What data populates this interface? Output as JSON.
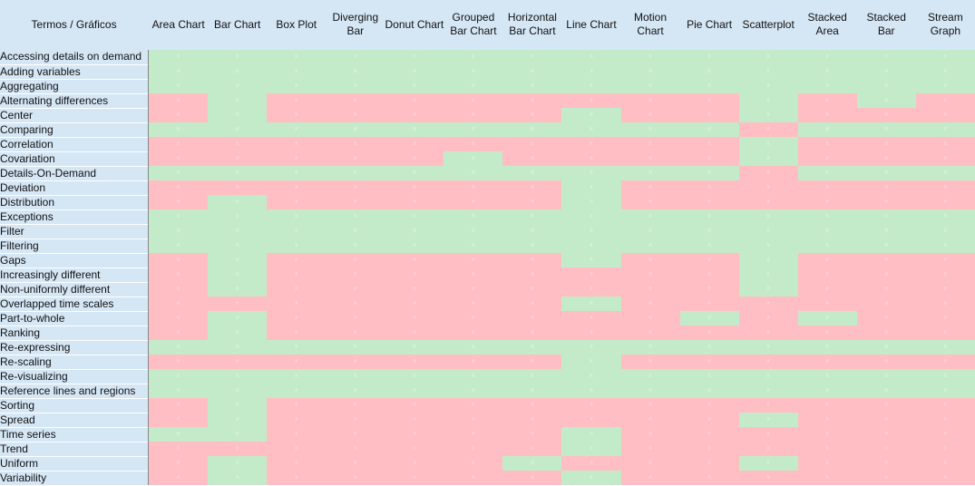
{
  "header": {
    "corner": "Termos / Gráficos",
    "columns": [
      "Area Chart",
      "Bar Chart",
      "Box Plot",
      "Diverging Bar",
      "Donut Chart",
      "Grouped Bar Chart",
      "Horizontal Bar Chart",
      "Line Chart",
      "Motion Chart",
      "Pie Chart",
      "Scatterplot",
      "Stacked Area",
      "Stacked Bar",
      "Stream Graph"
    ]
  },
  "colors": {
    "header_bg": "#d5e6f5",
    "yes": "#c4ebc9",
    "no": "#ffbec4"
  },
  "cell_mark": "x",
  "rows": [
    {
      "label": "Accessing details on demand",
      "values": [
        1,
        1,
        1,
        1,
        1,
        1,
        1,
        1,
        1,
        1,
        1,
        1,
        1,
        1
      ]
    },
    {
      "label": "Adding variables",
      "values": [
        1,
        1,
        1,
        1,
        1,
        1,
        1,
        1,
        1,
        1,
        1,
        1,
        1,
        1
      ]
    },
    {
      "label": "Aggregating",
      "values": [
        1,
        1,
        1,
        1,
        1,
        1,
        1,
        1,
        1,
        1,
        1,
        1,
        1,
        1
      ]
    },
    {
      "label": "Alternating differences",
      "values": [
        0,
        1,
        0,
        0,
        0,
        0,
        0,
        0,
        0,
        0,
        1,
        0,
        1,
        0
      ]
    },
    {
      "label": "Center",
      "values": [
        0,
        1,
        0,
        0,
        0,
        0,
        0,
        1,
        0,
        0,
        1,
        0,
        0,
        0
      ]
    },
    {
      "label": "Comparing",
      "values": [
        1,
        1,
        1,
        1,
        1,
        1,
        1,
        1,
        1,
        1,
        0,
        1,
        1,
        1
      ]
    },
    {
      "label": "Correlation",
      "values": [
        0,
        0,
        0,
        0,
        0,
        0,
        0,
        0,
        0,
        0,
        1,
        0,
        0,
        0
      ]
    },
    {
      "label": "Covariation",
      "values": [
        0,
        0,
        0,
        0,
        0,
        1,
        0,
        0,
        0,
        0,
        1,
        0,
        0,
        0
      ]
    },
    {
      "label": "Details-On-Demand",
      "values": [
        1,
        1,
        1,
        1,
        1,
        1,
        1,
        1,
        1,
        1,
        0,
        1,
        1,
        1
      ]
    },
    {
      "label": "Deviation",
      "values": [
        0,
        0,
        0,
        0,
        0,
        0,
        0,
        1,
        0,
        0,
        0,
        0,
        0,
        0
      ]
    },
    {
      "label": "Distribution",
      "values": [
        0,
        1,
        0,
        0,
        0,
        0,
        0,
        1,
        0,
        0,
        0,
        0,
        0,
        0
      ]
    },
    {
      "label": "Exceptions",
      "values": [
        1,
        1,
        1,
        1,
        1,
        1,
        1,
        1,
        1,
        1,
        1,
        1,
        1,
        1
      ]
    },
    {
      "label": "Filter",
      "values": [
        1,
        1,
        1,
        1,
        1,
        1,
        1,
        1,
        1,
        1,
        1,
        1,
        1,
        1
      ]
    },
    {
      "label": "Filtering",
      "values": [
        1,
        1,
        1,
        1,
        1,
        1,
        1,
        1,
        1,
        1,
        1,
        1,
        1,
        1
      ]
    },
    {
      "label": "Gaps",
      "values": [
        0,
        1,
        0,
        0,
        0,
        0,
        0,
        1,
        0,
        0,
        1,
        0,
        0,
        0
      ]
    },
    {
      "label": "Increasingly different",
      "values": [
        0,
        1,
        0,
        0,
        0,
        0,
        0,
        0,
        0,
        0,
        1,
        0,
        0,
        0
      ]
    },
    {
      "label": "Non-uniformly different",
      "values": [
        0,
        1,
        0,
        0,
        0,
        0,
        0,
        0,
        0,
        0,
        1,
        0,
        0,
        0
      ]
    },
    {
      "label": "Overlapped time scales",
      "values": [
        0,
        0,
        0,
        0,
        0,
        0,
        0,
        1,
        0,
        0,
        0,
        0,
        0,
        0
      ]
    },
    {
      "label": "Part-to-whole",
      "values": [
        0,
        1,
        0,
        0,
        0,
        0,
        0,
        0,
        0,
        1,
        0,
        1,
        0,
        0
      ]
    },
    {
      "label": "Ranking",
      "values": [
        0,
        1,
        0,
        0,
        0,
        0,
        0,
        0,
        0,
        0,
        0,
        0,
        0,
        0
      ]
    },
    {
      "label": "Re-expressing",
      "values": [
        1,
        1,
        1,
        1,
        1,
        1,
        1,
        1,
        1,
        1,
        1,
        1,
        1,
        1
      ]
    },
    {
      "label": "Re-scaling",
      "values": [
        0,
        0,
        0,
        0,
        0,
        0,
        0,
        1,
        0,
        0,
        0,
        0,
        0,
        0
      ]
    },
    {
      "label": "Re-visualizing",
      "values": [
        1,
        1,
        1,
        1,
        1,
        1,
        1,
        1,
        1,
        1,
        1,
        1,
        1,
        1
      ]
    },
    {
      "label": "Reference lines and regions",
      "values": [
        1,
        1,
        1,
        1,
        1,
        1,
        1,
        1,
        1,
        1,
        1,
        1,
        1,
        1
      ]
    },
    {
      "label": "Sorting",
      "values": [
        0,
        1,
        0,
        0,
        0,
        0,
        0,
        0,
        0,
        0,
        0,
        0,
        0,
        0
      ]
    },
    {
      "label": "Spread",
      "values": [
        0,
        1,
        0,
        0,
        0,
        0,
        0,
        0,
        0,
        0,
        1,
        0,
        0,
        0
      ]
    },
    {
      "label": "Time series",
      "values": [
        1,
        1,
        0,
        0,
        0,
        0,
        0,
        1,
        0,
        0,
        0,
        0,
        0,
        0
      ]
    },
    {
      "label": "Trend",
      "values": [
        0,
        0,
        0,
        0,
        0,
        0,
        0,
        1,
        0,
        0,
        0,
        0,
        0,
        0
      ]
    },
    {
      "label": "Uniform",
      "values": [
        0,
        1,
        0,
        0,
        0,
        0,
        1,
        0,
        0,
        0,
        1,
        0,
        0,
        0
      ]
    },
    {
      "label": "Variability",
      "values": [
        0,
        1,
        0,
        0,
        0,
        0,
        0,
        1,
        0,
        0,
        0,
        0,
        0,
        0
      ]
    }
  ]
}
